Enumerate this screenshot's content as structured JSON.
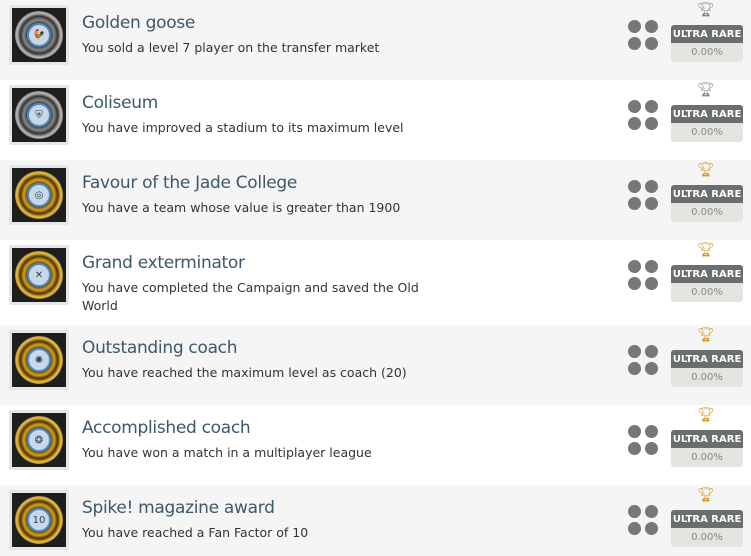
{
  "achievements": [
    {
      "title": "Golden goose",
      "description": "You sold a level 7 player on the transfer market",
      "rarity": "ULTRA RARE",
      "percent": "0.00%",
      "tier": "silver",
      "core": "🐓"
    },
    {
      "title": "Coliseum",
      "description": "You have improved a stadium to its maximum level",
      "rarity": "ULTRA RARE",
      "percent": "0.00%",
      "tier": "silver",
      "core": "⛨"
    },
    {
      "title": "Favour of the Jade College",
      "description": "You have a team whose value is greater than 1900",
      "rarity": "ULTRA RARE",
      "percent": "0.00%",
      "tier": "gold",
      "core": "◎"
    },
    {
      "title": "Grand exterminator",
      "description": "You have completed the Campaign and saved the Old World",
      "rarity": "ULTRA RARE",
      "percent": "0.00%",
      "tier": "gold",
      "core": "✕"
    },
    {
      "title": "Outstanding coach",
      "description": "You have reached the maximum level as coach (20)",
      "rarity": "ULTRA RARE",
      "percent": "0.00%",
      "tier": "gold",
      "core": "✺"
    },
    {
      "title": "Accomplished coach",
      "description": "You have won a match in a multiplayer league",
      "rarity": "ULTRA RARE",
      "percent": "0.00%",
      "tier": "gold",
      "core": "❂"
    },
    {
      "title": "Spike! magazine award",
      "description": "You have reached a Fan Factor of 10",
      "rarity": "ULTRA RARE",
      "percent": "0.00%",
      "tier": "gold",
      "core": "10"
    }
  ],
  "colors": {
    "trophy_silver": "#8a8a8a",
    "trophy_gold": "#d69a2a",
    "badge": "#6a6e6e"
  }
}
